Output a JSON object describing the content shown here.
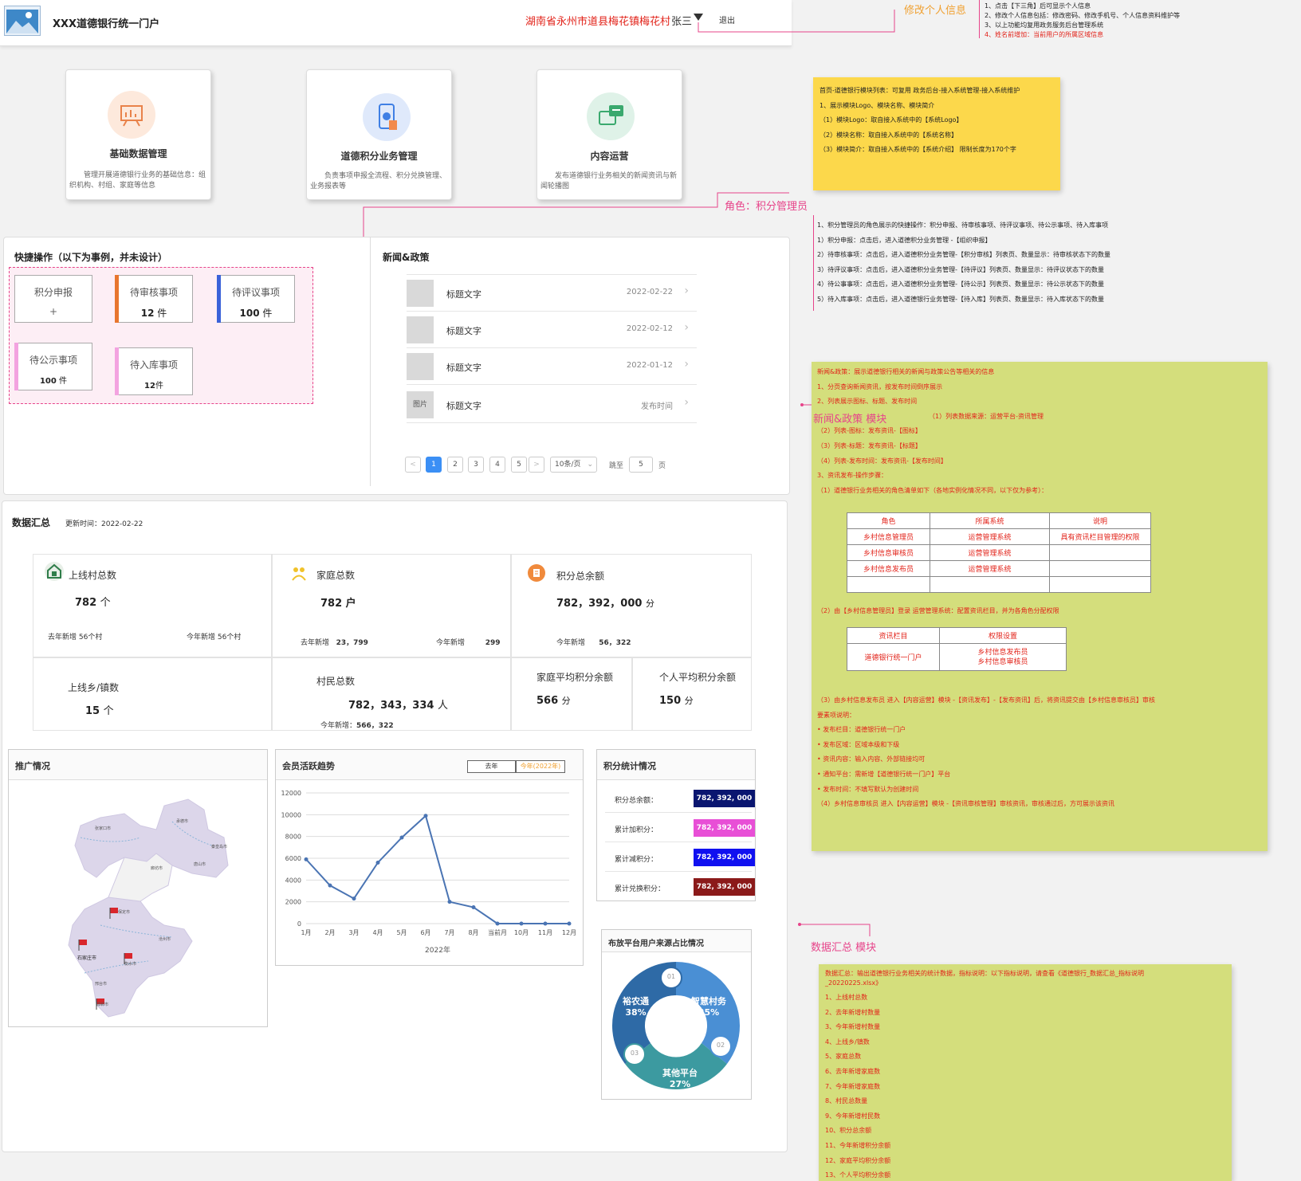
{
  "header": {
    "title": "XXX道德银行统一门户",
    "location": "湖南省永州市道县梅花镇梅花村",
    "user": "张三",
    "logout": "退出"
  },
  "annot_profile": {
    "title": "修改个人信息",
    "lines": [
      "1、点击【下三角】后可显示个人信息",
      "2、修改个人信息包括：修改密码、修改手机号、个人信息资料维护等",
      "3、以上功能均复用政务服务后台管理系统",
      "4、姓名前增加：当前用户的所属区域信息"
    ]
  },
  "modules": [
    {
      "name": "基础数据管理",
      "desc": "管理开展道德银行业务的基础信息：组织机构、村组、家庭等信息"
    },
    {
      "name": "道德积分业务管理",
      "desc": "负责事项申报全流程、积分兑换管理、业务报表等"
    },
    {
      "name": "内容运营",
      "desc": "发布道德银行业务相关的新闻资讯与新闻轮播图"
    }
  ],
  "yellow_note": {
    "lines": [
      "首页-道德银行模块列表：可复用 政务后台-接入系统管理-接入系统维护",
      "1、展示模块Logo、模块名称、模块简介",
      "（1）模块Logo：取自接入系统中的【系统Logo】",
      "（2）模块名称：取自接入系统中的【系统名称】",
      "（3）模块简介：取自接入系统中的【系统介绍】 限制长度为170个字"
    ]
  },
  "role_note": {
    "title": "角色：积分管理员",
    "lines": [
      "1、积分管理员的角色展示的快捷操作：积分申报、待审核事项、待评议事项、待公示事项、待入库事项",
      "1）积分申报：点击后，进入道德积分业务管理 -【组织申报】",
      "2）待审核事项：点击后，进入道德积分业务管理-【积分审核】列表页、数量显示：待审核状态下的数量",
      "3）待评议事项：点击后，进入道德积分业务管理-【待评议】列表页、数量显示：待评议状态下的数量",
      "4）待公事事项：点击后，进入道德积分业务管理-【待公示】列表页、数量显示：待公示状态下的数量",
      "5）待入库事项：点击后，进入道德银行业务管理-【待入库】列表页、数量显示：待入库状态下的数量"
    ]
  },
  "quick": {
    "title": "快捷操作（以下为事例，并未设计）",
    "items": [
      {
        "label": "积分申报",
        "value": "+"
      },
      {
        "label": "待审核事项",
        "num": "12",
        "unit": " 件"
      },
      {
        "label": "待评议事项",
        "num": "100",
        "unit": " 件"
      },
      {
        "label": "待公示事项",
        "num": "100",
        "unit": " 件"
      },
      {
        "label": "待入库事项",
        "num": "12",
        "unit": "件"
      }
    ]
  },
  "news": {
    "title": "新闻&政策",
    "rows": [
      {
        "thumb": "",
        "title": "标题文字",
        "date": "2022-02-22"
      },
      {
        "thumb": "",
        "title": "标题文字",
        "date": "2022-02-12"
      },
      {
        "thumb": "",
        "title": "标题文字",
        "date": "2022-01-12"
      },
      {
        "thumb": "图片",
        "title": "标题文字",
        "date": "发布时间"
      }
    ],
    "pager": {
      "pages": [
        "1",
        "2",
        "3",
        "4",
        "5"
      ],
      "prev": "<",
      "next": ">",
      "size": "10条/页",
      "jump": "跳至",
      "jump_val": "5",
      "page_unit": "页"
    }
  },
  "news_note": {
    "label": "新闻&政策 模块",
    "lines": [
      "新闻&政策：展示道德银行相关的新闻与政策公告等相关的信息",
      "1、分页查询新闻资讯，按发布时间倒序展示",
      "2、列表展示图标、标题、发布时间",
      "（1）列表数据来源：运营平台-资讯管理",
      "（2）列表-图标：发布资讯-【图标】",
      "（3）列表-标题：发布资讯-【标题】",
      "（4）列表-发布时间：发布资讯-【发布时间】",
      "3、资讯发布-操作步骤：",
      "（1）道德银行业务相关的角色清单如下（各地实例化情况不同，以下仅为参考）："
    ],
    "table1": {
      "head": [
        "角色",
        "所属系统",
        "说明"
      ],
      "rows": [
        [
          "乡村信息管理员",
          "运营管理系统",
          "具有资讯栏目管理的权限"
        ],
        [
          "乡村信息审核员",
          "运营管理系统",
          ""
        ],
        [
          "乡村信息发布员",
          "运营管理系统",
          ""
        ],
        [
          "",
          "",
          ""
        ]
      ]
    },
    "step2": "（2）由【乡村信息管理员】登录 运营管理系统：配置资讯栏目，并为各角色分配权限",
    "table2": {
      "head": [
        "资讯栏目",
        "权限设置"
      ],
      "row": [
        "道德银行统一门户",
        "乡村信息发布员",
        "乡村信息审核员"
      ]
    },
    "lines2": [
      "（3）由乡村信息发布员 进入【内容运营】模块 -【资讯发布】-【发布资讯】后，将资讯提交由【乡村信息审核员】审核",
      "要素项说明：",
      "• 发布栏目：道德银行统一门户",
      "• 发布区域：区域本级和下级",
      "• 资讯内容：输入内容、外部链接均可",
      "• 通知平台：需新增【道德银行统一门户】平台",
      "• 发布时间：不填写默认为创建时间",
      "（4）乡村信息审核员 进入【内容运营】模块 -【资讯审核管理】审核资讯，审核通过后，方可展示该资讯"
    ]
  },
  "summary": {
    "title": "数据汇总",
    "updated": "更新时间：2022-02-22",
    "villages": {
      "label": "上线村总数",
      "value": "782",
      "unit": "个",
      "last": "去年新增  56个村",
      "this": "今年新增  56个村"
    },
    "families": {
      "label": "家庭总数",
      "value": "782",
      "unit": "户",
      "last_lbl": "去年新增",
      "last": "23，799",
      "this_lbl": "今年新增",
      "this": "299"
    },
    "points": {
      "label": "积分总余额",
      "value": "782，392，000",
      "unit": "分",
      "last_lbl": "今年新增",
      "last": "56，322"
    },
    "towns": {
      "label": "上线乡/镇数",
      "value": "15",
      "unit": "个"
    },
    "villagers": {
      "label": "村民总数",
      "value": "782，343，334",
      "unit": "人",
      "this": "今年新增：",
      "this_val": "566，322"
    },
    "fam_avg": {
      "label": "家庭平均积分余额",
      "value": "566",
      "unit": "分"
    },
    "per_avg": {
      "label": "个人平均积分余额",
      "value": "150",
      "unit": "分"
    }
  },
  "promo": {
    "title": "推广情况",
    "cities": [
      "张家口市",
      "承德市",
      "秦皇岛市",
      "唐山市",
      "保定市",
      "沧州市",
      "石家庄市",
      "衡水市",
      "邢台市",
      "邯郸市",
      "廊坊市"
    ]
  },
  "trend": {
    "title": "会员活跃趋势",
    "tab_last": "去年",
    "tab_this": "今年(2022年)"
  },
  "chart_data": {
    "type": "line",
    "title": "会员活跃趋势",
    "xlabel": "2022年",
    "categories": [
      "1月",
      "2月",
      "3月",
      "4月",
      "5月",
      "6月",
      "7月",
      "8月",
      "当前月",
      "10月",
      "11月",
      "12月"
    ],
    "values": [
      5900,
      3500,
      2300,
      5600,
      7900,
      9900,
      2000,
      1500,
      0,
      0,
      0,
      0
    ],
    "ylim": [
      0,
      12000
    ],
    "yticks": [
      "0",
      "2000",
      "4000",
      "6000",
      "8000",
      "10000",
      "12000"
    ],
    "grid": true,
    "color": "#4a74b3"
  },
  "pstats": {
    "title": "积分统计情况",
    "rows": [
      {
        "k": "积分总余额：",
        "v": "782, 392, 000",
        "color": "#0a1670"
      },
      {
        "k": "累计加积分：",
        "v": "782, 392, 000",
        "color": "#e84fd6"
      },
      {
        "k": "累计减积分：",
        "v": "782, 392, 000",
        "color": "#1010f0"
      },
      {
        "k": "累计兑换积分：",
        "v": "782, 392, 000",
        "color": "#8b1a1a"
      }
    ]
  },
  "source": {
    "title": "布放平台用户来源占比情况",
    "slices": [
      {
        "name": "裕农通",
        "pct": "38%",
        "num": "01",
        "value": 38,
        "color": "#2e6aa6"
      },
      {
        "name": "智慧村务",
        "pct": "35%",
        "num": "02",
        "value": 35,
        "color": "#4a8fd4"
      },
      {
        "name": "其他平台",
        "pct": "27%",
        "num": "03",
        "value": 27,
        "color": "#3c9aa0"
      }
    ]
  },
  "summary_note": {
    "label": "数据汇总 模块",
    "lines": [
      "数据汇总：输出道德银行业务相关的统计数据，指标说明：以下指标说明，请查看《道德银行_数据汇总_指标说明_20220225.xlsx》",
      "1、上线村总数",
      "2、去年新增村数量",
      "3、今年新增村数量",
      "4、上线乡/镇数",
      "5、家庭总数",
      "6、去年新增家庭数",
      "7、今年新增家庭数",
      "8、村民总数量",
      "9、今年新增村民数",
      "10、积分总余额",
      "11、今年新增积分余额",
      "12、家庭平均积分余额",
      "13、个人平均积分余额"
    ]
  }
}
